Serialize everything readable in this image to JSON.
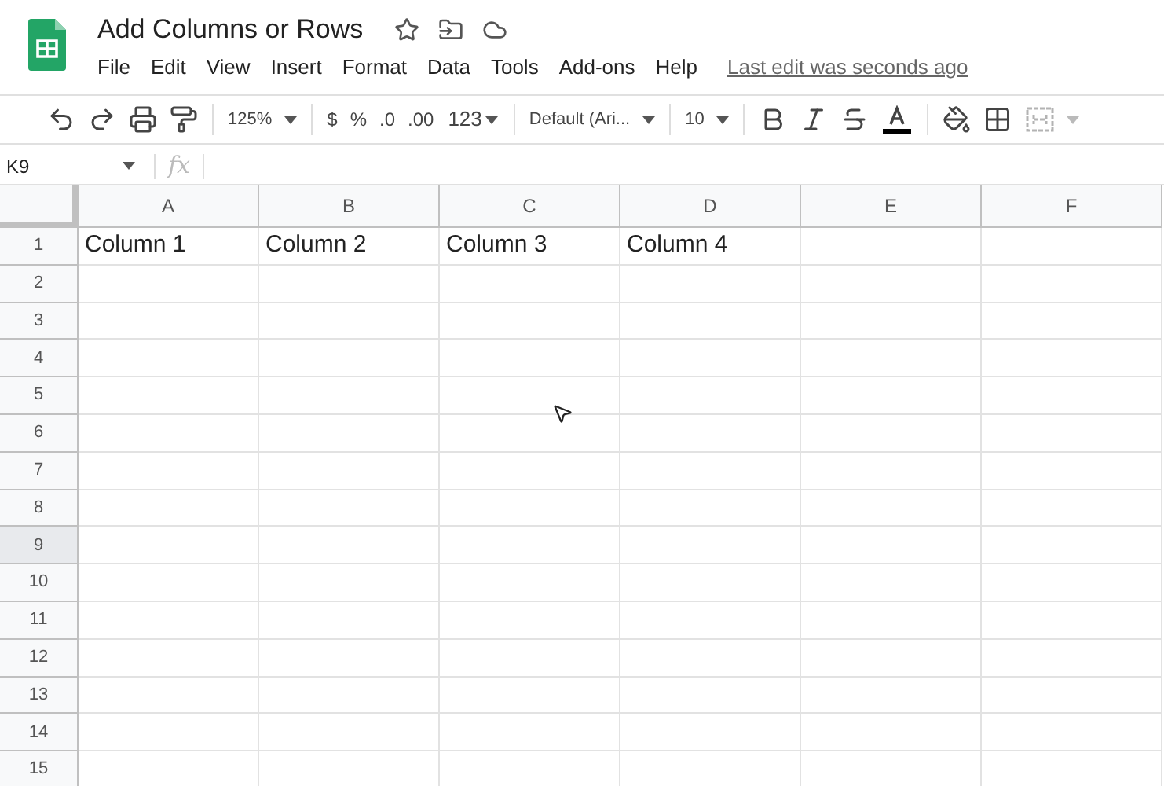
{
  "document": {
    "title": "Add Columns or Rows",
    "last_edit": "Last edit was seconds ago"
  },
  "menu": [
    "File",
    "Edit",
    "View",
    "Insert",
    "Format",
    "Data",
    "Tools",
    "Add-ons",
    "Help"
  ],
  "toolbar": [
    {
      "kind": "undo"
    },
    {
      "kind": "redo"
    },
    {
      "kind": "print"
    },
    {
      "kind": "paint"
    },
    {
      "kind": "sep"
    },
    {
      "kind": "dropdown",
      "label": "125%"
    },
    {
      "kind": "sep"
    },
    {
      "kind": "text",
      "label": "$"
    },
    {
      "kind": "text",
      "label": "%"
    },
    {
      "kind": "decdown",
      "label": ".0"
    },
    {
      "kind": "decup",
      "label": ".00"
    },
    {
      "kind": "menu",
      "label": "123"
    },
    {
      "kind": "sep"
    },
    {
      "kind": "dropdown",
      "label": "Default (Ari..."
    },
    {
      "kind": "sep"
    },
    {
      "kind": "dropdown",
      "label": "10"
    },
    {
      "kind": "sep"
    },
    {
      "kind": "bold"
    },
    {
      "kind": "italic"
    },
    {
      "kind": "strike"
    },
    {
      "kind": "textcolor"
    },
    {
      "kind": "sep"
    },
    {
      "kind": "fill"
    },
    {
      "kind": "borders"
    },
    {
      "kind": "merge",
      "disabled": true
    }
  ],
  "name_box": "K9",
  "formula_label": "fx",
  "columns": [
    "A",
    "B",
    "C",
    "D",
    "E",
    "F"
  ],
  "rows": [
    {
      "label": "1",
      "selected": false,
      "cells": [
        "Column 1",
        "Column 2",
        "Column 3",
        "Column 4"
      ]
    },
    {
      "label": "2",
      "selected": false,
      "cells": []
    },
    {
      "label": "3",
      "selected": false,
      "cells": []
    },
    {
      "label": "4",
      "selected": false,
      "cells": []
    },
    {
      "label": "5",
      "selected": false,
      "cells": []
    },
    {
      "label": "6",
      "selected": false,
      "cells": []
    },
    {
      "label": "7",
      "selected": false,
      "cells": []
    },
    {
      "label": "8",
      "selected": false,
      "cells": []
    },
    {
      "label": "9",
      "selected": true,
      "cells": []
    },
    {
      "label": "10",
      "selected": false,
      "cells": []
    },
    {
      "label": "11",
      "selected": false,
      "cells": []
    },
    {
      "label": "12",
      "selected": false,
      "cells": []
    },
    {
      "label": "13",
      "selected": false,
      "cells": []
    },
    {
      "label": "14",
      "selected": false,
      "cells": []
    },
    {
      "label": "15",
      "selected": false,
      "cells": []
    }
  ]
}
